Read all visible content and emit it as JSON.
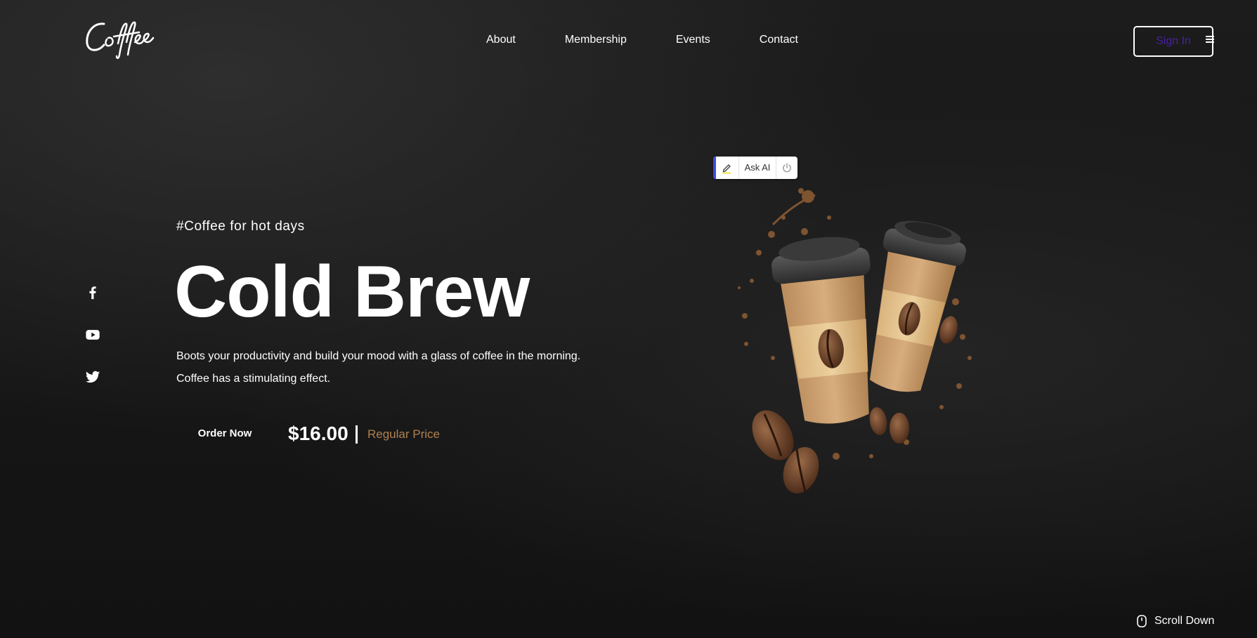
{
  "header": {
    "logo_text": "Coffee",
    "nav": [
      {
        "label": "About"
      },
      {
        "label": "Membership"
      },
      {
        "label": "Events"
      },
      {
        "label": "Contact"
      }
    ],
    "signin_label": "Sign In",
    "menu_icon": "hamburger-icon"
  },
  "social": {
    "icons": [
      "facebook-icon",
      "youtube-icon",
      "twitter-icon"
    ]
  },
  "hero": {
    "tagline": "#Coffee for hot days",
    "title": "Cold Brew",
    "description_line1": "Boots your productivity and build your mood with a glass of coffee in the morning.",
    "description_line2": "Coffee has a stimulating effect.",
    "order_label": "Order Now",
    "price": "$16.00",
    "price_label": "Regular Price",
    "illustration": "coffee-cups-illustration"
  },
  "askai": {
    "label": "Ask AI",
    "icons": [
      "highlighter-icon",
      "power-icon"
    ]
  },
  "scroll": {
    "label": "Scroll Down",
    "icon": "mouse-icon"
  },
  "colors": {
    "background": "#171717",
    "signin_text": "#4b1fa6",
    "price_label": "#b0814f",
    "askai_accent": "#3b4ee0"
  }
}
